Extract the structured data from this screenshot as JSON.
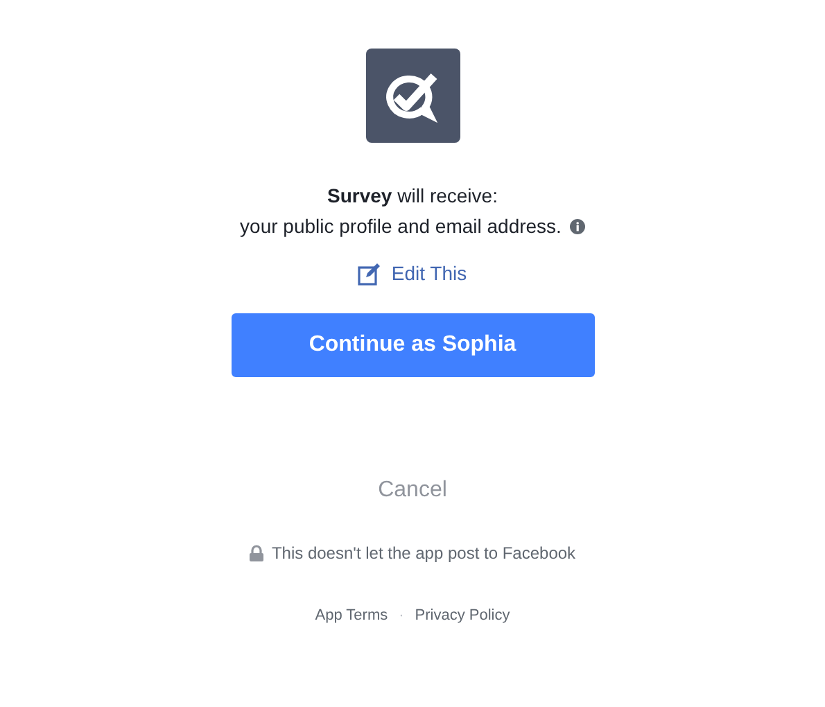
{
  "permission": {
    "text": "**Survey** will receive:",
    "detail": "your public profile and email address."
  },
  "edit_link": "Edit This",
  "continue_button": "Continue as Sophia",
  "cancel": "Cancel",
  "notice": "This doesn't let the app post to Facebook",
  "footer": {
    "links": [
      "App Terms",
      "Privacy Policy"
    ],
    "separator": "·"
  }
}
